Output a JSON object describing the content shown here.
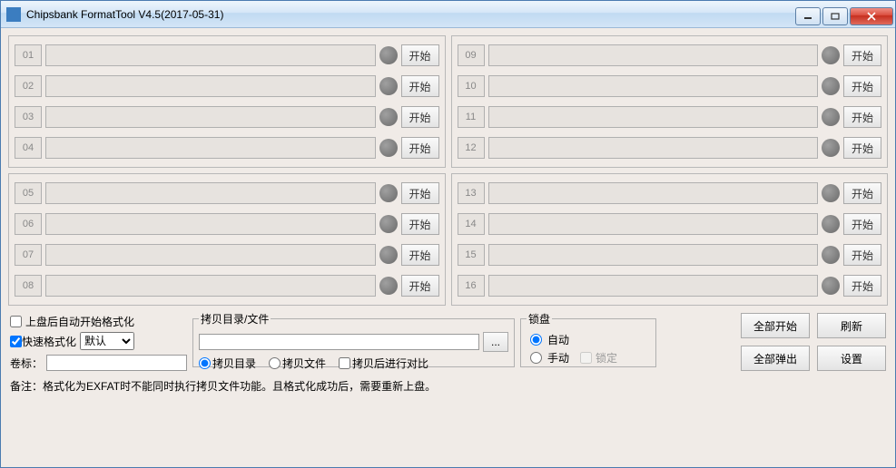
{
  "window": {
    "title": "Chipsbank FormatTool V4.5(2017-05-31)"
  },
  "slot_start_label": "开始",
  "slots_left_top": [
    "01",
    "02",
    "03",
    "04"
  ],
  "slots_right_top": [
    "09",
    "10",
    "11",
    "12"
  ],
  "slots_left_bot": [
    "05",
    "06",
    "07",
    "08"
  ],
  "slots_right_bot": [
    "13",
    "14",
    "15",
    "16"
  ],
  "options": {
    "auto_format_on_insert": "上盘后自动开始格式化",
    "quick_format": "快速格式化",
    "quick_format_select": "默认",
    "volume_label_label": "卷标："
  },
  "copy": {
    "legend": "拷贝目录/文件",
    "opt_dir": "拷贝目录",
    "opt_file": "拷贝文件",
    "opt_compare": "拷贝后进行对比",
    "browse": "..."
  },
  "lock": {
    "legend": "锁盘",
    "opt_auto": "自动",
    "opt_manual": "手动",
    "chk_lock": "锁定"
  },
  "buttons": {
    "start_all": "全部开始",
    "refresh": "刷新",
    "eject_all": "全部弹出",
    "settings": "设置"
  },
  "footnote": "备注：格式化为EXFAT时不能同时执行拷贝文件功能。且格式化成功后，需要重新上盘。"
}
